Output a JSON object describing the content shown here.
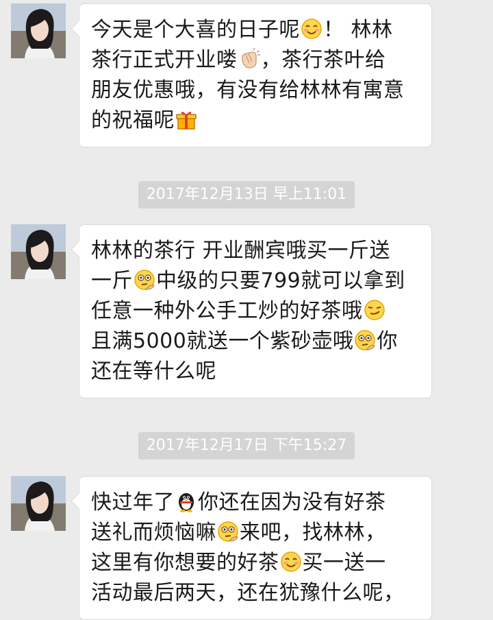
{
  "messages": [
    {
      "segments": [
        {
          "t": "今天是个大喜的日子呢"
        },
        {
          "icon": "smile-emoji"
        },
        {
          "t": "！ 林林\n茶行正式开业喽"
        },
        {
          "icon": "clap-emoji"
        },
        {
          "t": "，茶行茶叶给\n朋友优惠哦，有没有给林林有寓意\n的祝福呢"
        },
        {
          "icon": "gift-emoji"
        }
      ]
    },
    {
      "segments": [
        {
          "t": "林林的茶行 开业酬宾哦买一斤送\n一斤"
        },
        {
          "icon": "thinking-emoji"
        },
        {
          "t": "中级的只要799就可以拿到\n任意一种外公手工炒的好茶哦"
        },
        {
          "icon": "smirk-emoji"
        },
        {
          "t": "\n且满5000就送一个紫砂壶哦"
        },
        {
          "icon": "thinking-emoji"
        },
        {
          "t": "你\n还在等什么呢"
        }
      ]
    },
    {
      "segments": [
        {
          "t": "快过年了"
        },
        {
          "icon": "penguin-emoji"
        },
        {
          "t": "你还在因为没有好茶\n送礼而烦恼嘛"
        },
        {
          "icon": "thinking-emoji"
        },
        {
          "t": "来吧，找林林，\n这里有你想要的好茶"
        },
        {
          "icon": "smile-emoji"
        },
        {
          "t": "买一送一\n活动最后两天，还在犹豫什么呢，"
        }
      ]
    }
  ],
  "timestamps": [
    "2017年12月13日 早上11:01",
    "2017年12月17日 下午15:27"
  ]
}
